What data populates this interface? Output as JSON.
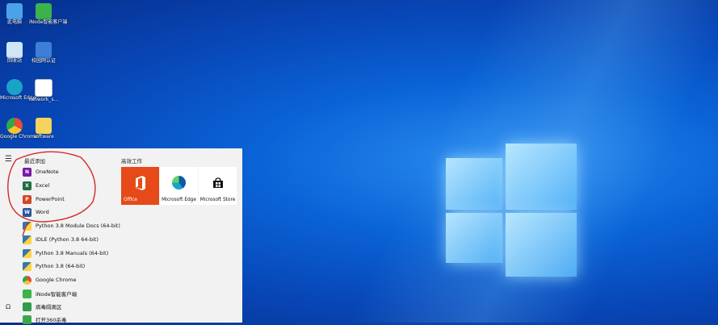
{
  "desktop": {
    "icons": [
      {
        "label": "此电脑",
        "icon": "computer-icon",
        "color": "#4aa3e8"
      },
      {
        "label": "iNode智能客户端",
        "icon": "inode-icon",
        "color": "#3bb24a"
      },
      {
        "label": "回收站",
        "icon": "recycle-bin-icon",
        "color": "#cfe6f7"
      },
      {
        "label": "校园网认证",
        "icon": "network-auth-icon",
        "color": "#3d7fd6"
      },
      {
        "label": "Microsoft Edge",
        "icon": "edge-icon",
        "color": "#1aa3c8"
      },
      {
        "label": "network_s...",
        "icon": "file-icon",
        "color": "#ffffff"
      },
      {
        "label": "Google Chrome",
        "icon": "chrome-icon",
        "color": "#e84a3b"
      },
      {
        "label": "software",
        "icon": "folder-icon",
        "color": "#f4d35e"
      }
    ]
  },
  "start_menu": {
    "recent_title": "最近添加",
    "pinned_title": "高效工作",
    "apps": [
      {
        "label": "OneNote",
        "icon": "onenote-icon",
        "color": "#7719aa",
        "glyph": "N"
      },
      {
        "label": "Excel",
        "icon": "excel-icon",
        "color": "#1d6f42",
        "glyph": "X"
      },
      {
        "label": "PowerPoint",
        "icon": "powerpoint-icon",
        "color": "#d24726",
        "glyph": "P"
      },
      {
        "label": "Word",
        "icon": "word-icon",
        "color": "#2b579a",
        "glyph": "W"
      },
      {
        "label": "Python 3.8 Module Docs (64-bit)",
        "icon": "python-icon",
        "color": "#3776ab",
        "glyph": ""
      },
      {
        "label": "IDLE (Python 3.8 64-bit)",
        "icon": "python-icon",
        "color": "#3776ab",
        "glyph": ""
      },
      {
        "label": "Python 3.8 Manuals (64-bit)",
        "icon": "python-icon",
        "color": "#3776ab",
        "glyph": ""
      },
      {
        "label": "Python 3.8 (64-bit)",
        "icon": "python-icon",
        "color": "#3776ab",
        "glyph": ""
      },
      {
        "label": "Google Chrome",
        "icon": "chrome-icon",
        "color": "#e84a3b",
        "glyph": ""
      },
      {
        "label": "iNode智能客户端",
        "icon": "inode-icon",
        "color": "#3bb24a",
        "glyph": ""
      },
      {
        "label": "病毒隔离区",
        "icon": "quarantine-icon",
        "color": "#2e9e4d",
        "glyph": ""
      },
      {
        "label": "打开360杀毒",
        "icon": "360-antivirus-icon",
        "color": "#3aa84a",
        "glyph": ""
      }
    ],
    "tiles": [
      {
        "label": "Office",
        "icon": "office-icon",
        "bg": "#e64a19",
        "fg": "#ffffff"
      },
      {
        "label": "Microsoft Edge",
        "icon": "edge-icon",
        "bg": "#ffffff",
        "fg": "#111111"
      },
      {
        "label": "Microsoft Store",
        "icon": "store-icon",
        "bg": "#ffffff",
        "fg": "#111111"
      }
    ]
  }
}
